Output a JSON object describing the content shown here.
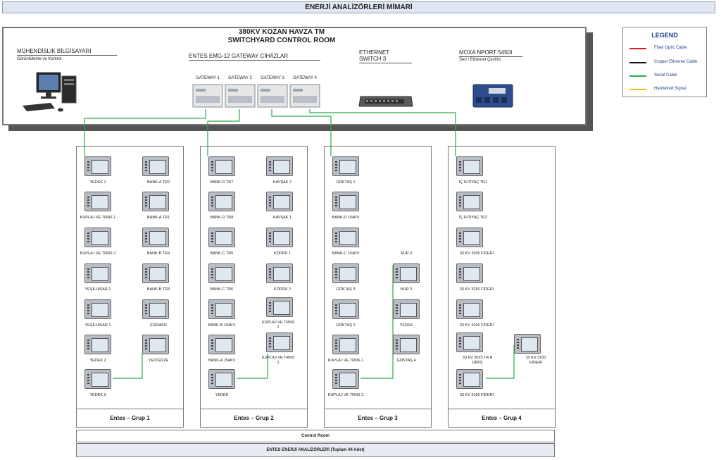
{
  "title": "ENERJİ ANALİZÖRLERİ MİMARİ",
  "control_room": {
    "title_line1": "380KV KOZAN HAVZA TM",
    "title_line2": "SWITCHYARD CONTROL ROOM",
    "computer_header": "MÜHENDİSLİK BİLGİSAYARI",
    "computer_sub": "Görüntüleme ve Kontrol",
    "gateway_header": "ENTES EMG-12 GATEWAY CİHAZLAR",
    "gateways": [
      "GATEWAY 1",
      "GATEWAY 2",
      "GATEWAY 3",
      "GATEWAY 4"
    ],
    "switch_header_1": "ETHERNET",
    "switch_header_2": "SWITCH 3",
    "moxa_header": "MOXA NPORT 5450I",
    "moxa_sub": "Seri / Ethernet Çevirici"
  },
  "legend": {
    "title": "LEGEND",
    "items": [
      {
        "label": "Fiber Optic Cable",
        "color": "#e02020"
      },
      {
        "label": "Copper Ethernet Cable",
        "color": "#111111"
      },
      {
        "label": "Serial Cable",
        "color": "#2aaa4a"
      },
      {
        "label": "Hardwired Signal",
        "color": "#f2c200"
      }
    ]
  },
  "groups": [
    {
      "label": "Entes – Grup 1",
      "left": [
        "YEDEK 1",
        "KUPLAJ VE TRNS 1",
        "KUPLAJ VE TRNS 2",
        "YEŞİLHİSAR 2",
        "YEŞİLHİSAR 1",
        "YEDEK 2",
        "YEDEK 3"
      ],
      "right": [
        "BANK-A TR2",
        "BANK-A TR1",
        "BANK-B TR4",
        "BANK-B TR3",
        "EGEMER",
        "YEDİGÖZE"
      ]
    },
    {
      "label": "Entes – Grup 2",
      "left": [
        "BANK-D TR7",
        "BANK-D TR8",
        "BANK-C TR5",
        "BANK-C TR6",
        "BANK-B 154KV",
        "BANK-A 154KV",
        "YEDEK"
      ],
      "right": [
        "KAVŞAK 2",
        "KAVŞAK 1",
        "KÖPRÜ 1",
        "KÖPRÜ 2",
        "KUPLAJ VE TRNS 2",
        "KUPLAJ VE TRNS 1"
      ]
    },
    {
      "label": "Entes – Grup 3",
      "left": [
        "GÖKTAŞ 1",
        "BANK-D 154KV",
        "BANK-C 154KV",
        "GÖKTAŞ 3",
        "GÖKTAŞ 2",
        "KUPLAJ VE TRNS 1",
        "KUPLAJ VE TRNS 2"
      ],
      "right": [
        "NUR 3",
        "NUR 3",
        "YEDEK",
        "GÖKTAŞ 4"
      ]
    },
    {
      "label": "Entes – Grup 4",
      "left": [
        "İÇ İHTİYAÇ TR1",
        "İÇ İHTİYAÇ TR2",
        "33 KV 3300 FİDERİ",
        "33 KV 3250 FİDERİ",
        "33 KV 3200 FİDERİ",
        "33 KV 3025 TR A GİRİŞ",
        "33 KV 3150 FİDERİ"
      ],
      "right": [
        "33 KV 3100 FİDERİ"
      ]
    }
  ],
  "footer": {
    "control_room": "Control Room",
    "total": "ENTES ENERJİ ANALİZÖRLERİ  (Toplam 44 Adet)"
  }
}
